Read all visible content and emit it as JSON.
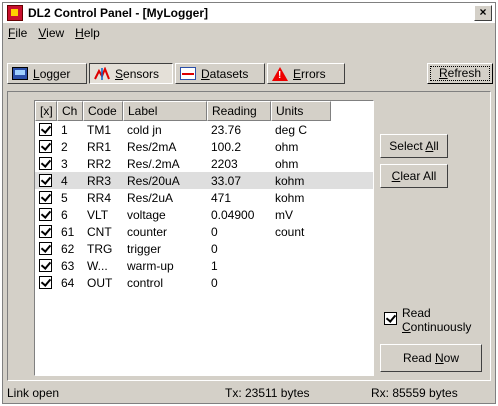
{
  "window": {
    "title": "DL2 Control Panel - [MyLogger]",
    "close_glyph": "×"
  },
  "menu": {
    "items": [
      {
        "key": "F",
        "rest": "ile"
      },
      {
        "key": "V",
        "rest": "iew"
      },
      {
        "key": "H",
        "rest": "elp"
      }
    ]
  },
  "tabs": [
    {
      "key": "L",
      "rest": "ogger",
      "icon": "logger-icon"
    },
    {
      "key": "S",
      "rest": "ensors",
      "icon": "sensors-icon",
      "active": true
    },
    {
      "key": "D",
      "rest": "atasets",
      "icon": "datasets-icon"
    },
    {
      "key": "E",
      "rest": "rrors",
      "icon": "errors-icon"
    }
  ],
  "toolbar": {
    "refresh_key": "R",
    "refresh_rest": "efresh"
  },
  "table": {
    "headers": [
      "[x]",
      "Ch",
      "Code",
      "Label",
      "Reading",
      "Units"
    ],
    "rows": [
      {
        "checked": true,
        "ch": "1",
        "code": "TM1",
        "label": "cold jn",
        "reading": "23.76",
        "units": "deg C"
      },
      {
        "checked": true,
        "ch": "2",
        "code": "RR1",
        "label": "Res/2mA",
        "reading": "100.2",
        "units": "ohm"
      },
      {
        "checked": true,
        "ch": "3",
        "code": "RR2",
        "label": "Res/.2mA",
        "reading": "2203",
        "units": "ohm"
      },
      {
        "checked": true,
        "ch": "4",
        "code": "RR3",
        "label": "Res/20uA",
        "reading": "33.07",
        "units": "kohm",
        "selected": true
      },
      {
        "checked": true,
        "ch": "5",
        "code": "RR4",
        "label": "Res/2uA",
        "reading": "471",
        "units": "kohm"
      },
      {
        "checked": true,
        "ch": "6",
        "code": "VLT",
        "label": "voltage",
        "reading": "0.04900",
        "units": "mV"
      },
      {
        "checked": true,
        "ch": "61",
        "code": "CNT",
        "label": "counter",
        "reading": "0",
        "units": "count"
      },
      {
        "checked": true,
        "ch": "62",
        "code": "TRG",
        "label": "trigger",
        "reading": "0",
        "units": ""
      },
      {
        "checked": true,
        "ch": "63",
        "code": "W...",
        "label": "warm-up",
        "reading": "1",
        "units": ""
      },
      {
        "checked": true,
        "ch": "64",
        "code": "OUT",
        "label": "control",
        "reading": "0",
        "units": ""
      }
    ]
  },
  "side": {
    "select_all_pre": "Select ",
    "select_all_key": "A",
    "select_all_post": "ll",
    "clear_all_key": "C",
    "clear_all_rest": "lear All",
    "read_cont_line1": "Read",
    "read_cont_key": "C",
    "read_cont_rest": "ontinuously",
    "read_cont_checked": true,
    "read_now_pre": "Read ",
    "read_now_key": "N",
    "read_now_post": "ow"
  },
  "status": {
    "link": "Link open",
    "tx": "Tx: 23511 bytes",
    "rx": "Rx: 85559 bytes"
  }
}
